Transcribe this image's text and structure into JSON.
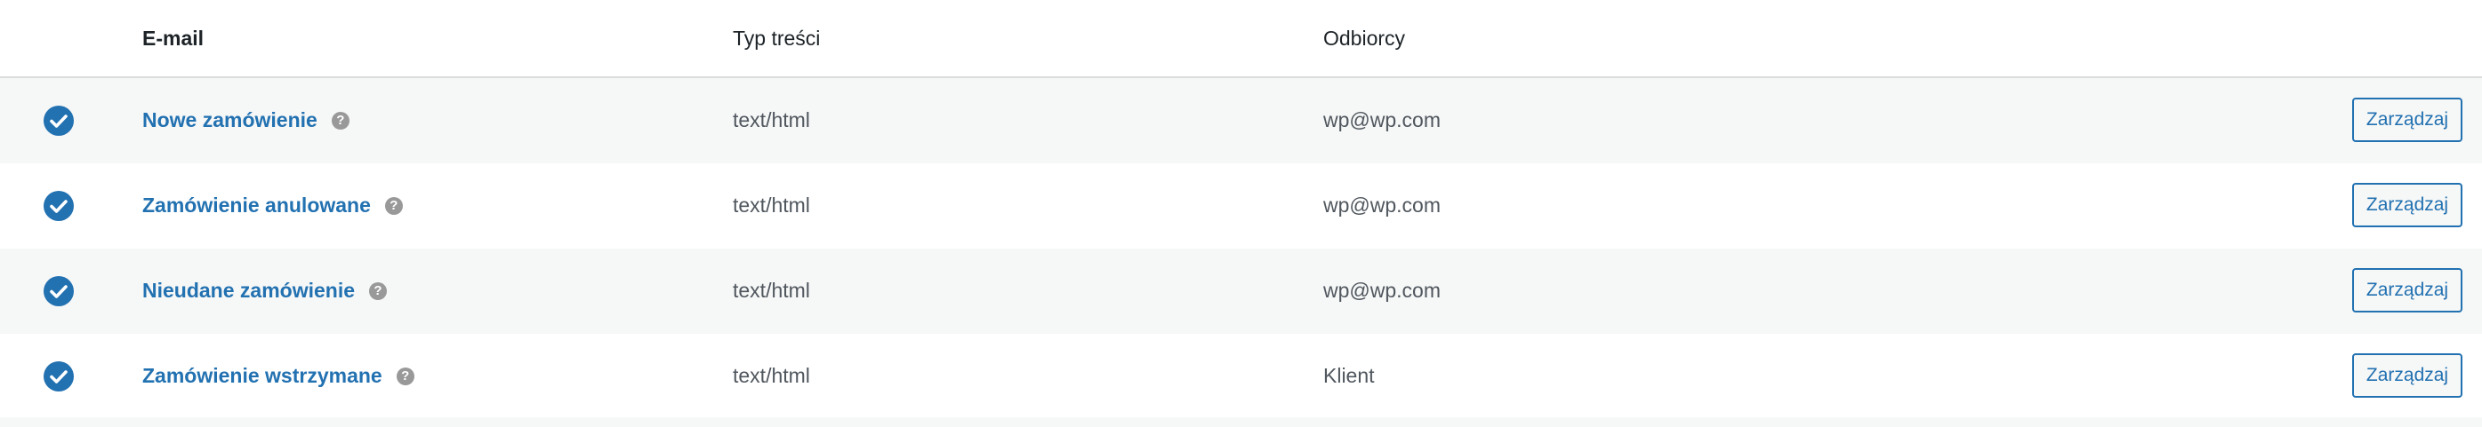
{
  "header": {
    "email": "E-mail",
    "content_type": "Typ treści",
    "recipients": "Odbiorcy"
  },
  "rows": [
    {
      "title": "Nowe zamówienie",
      "help_icon": "question-mark-icon",
      "content_type": "text/html",
      "recipient": "wp@wp.com",
      "manage_label": "Zarządzaj",
      "enabled": true
    },
    {
      "title": "Zamówienie anulowane",
      "help_icon": "question-mark-icon",
      "content_type": "text/html",
      "recipient": "wp@wp.com",
      "manage_label": "Zarządzaj",
      "enabled": true
    },
    {
      "title": "Nieudane zamówienie",
      "help_icon": "question-mark-icon",
      "content_type": "text/html",
      "recipient": "wp@wp.com",
      "manage_label": "Zarządzaj",
      "enabled": true
    },
    {
      "title": "Zamówienie wstrzymane",
      "help_icon": "question-mark-icon",
      "content_type": "text/html",
      "recipient": "Klient",
      "manage_label": "Zarządzaj",
      "enabled": true
    }
  ],
  "colors": {
    "accent": "#2271b1",
    "row_alt_bg": "#f6f7f7",
    "text": "#50575e",
    "heading": "#1d2327",
    "help_icon_bg": "#999999"
  }
}
